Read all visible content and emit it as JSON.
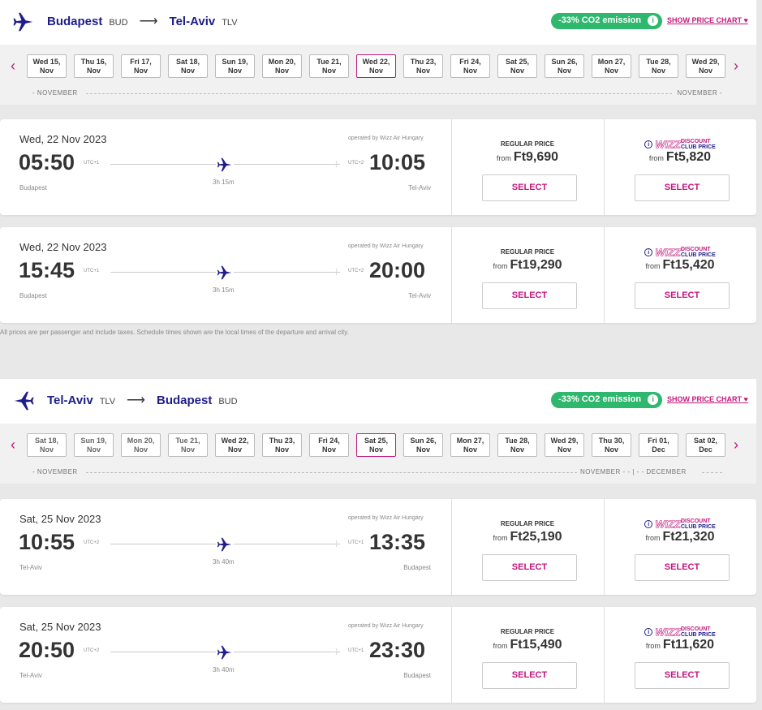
{
  "outbound": {
    "from_city": "Budapest",
    "from_iata": "BUD",
    "to_city": "Tel-Aviv",
    "to_iata": "TLV",
    "co2": "-33% CO2 emission",
    "price_chart": "SHOW PRICE CHART ♥",
    "dates": [
      [
        "Wed 15,",
        "Nov"
      ],
      [
        "Thu 16,",
        "Nov"
      ],
      [
        "Fri 17,",
        "Nov"
      ],
      [
        "Sat 18,",
        "Nov"
      ],
      [
        "Sun 19,",
        "Nov"
      ],
      [
        "Mon 20,",
        "Nov"
      ],
      [
        "Tue 21,",
        "Nov"
      ],
      [
        "Wed 22,",
        "Nov"
      ],
      [
        "Thu 23,",
        "Nov"
      ],
      [
        "Fri 24,",
        "Nov"
      ],
      [
        "Sat 25,",
        "Nov"
      ],
      [
        "Sun 26,",
        "Nov"
      ],
      [
        "Mon 27,",
        "Nov"
      ],
      [
        "Tue 28,",
        "Nov"
      ],
      [
        "Wed 29,",
        "Nov"
      ]
    ],
    "selected_date_index": 7,
    "month_left": "NOVEMBER",
    "month_right": "NOVEMBER",
    "flights": [
      {
        "date": "Wed, 22 Nov 2023",
        "operator": "operated by Wizz Air Hungary",
        "dep": "05:50",
        "dep_tz": "UTC+1",
        "arr": "10:05",
        "arr_tz": "UTC+2",
        "duration": "3h 15m",
        "from": "Budapest",
        "to": "Tel-Aviv",
        "regular_label": "REGULAR PRICE",
        "from_label": "from",
        "regular_price": "Ft9,690",
        "club_price": "Ft5,820",
        "select": "SELECT"
      },
      {
        "date": "Wed, 22 Nov 2023",
        "operator": "operated by Wizz Air Hungary",
        "dep": "15:45",
        "dep_tz": "UTC+1",
        "arr": "20:00",
        "arr_tz": "UTC+2",
        "duration": "3h 15m",
        "from": "Budapest",
        "to": "Tel-Aviv",
        "regular_label": "REGULAR PRICE",
        "from_label": "from",
        "regular_price": "Ft19,290",
        "club_price": "Ft15,420",
        "select": "SELECT"
      }
    ]
  },
  "disclaimer": "All prices are per passenger and include taxes. Schedule times shown are the local times of the departure and arrival city.",
  "inbound": {
    "from_city": "Tel-Aviv",
    "from_iata": "TLV",
    "to_city": "Budapest",
    "to_iata": "BUD",
    "co2": "-33% CO2 emission",
    "price_chart": "SHOW PRICE CHART ♥",
    "dates": [
      [
        "Sat 18,",
        "Nov"
      ],
      [
        "Sun 19,",
        "Nov"
      ],
      [
        "Mon 20,",
        "Nov"
      ],
      [
        "Tue 21,",
        "Nov"
      ],
      [
        "Wed 22,",
        "Nov"
      ],
      [
        "Thu 23,",
        "Nov"
      ],
      [
        "Fri 24,",
        "Nov"
      ],
      [
        "Sat 25,",
        "Nov"
      ],
      [
        "Sun 26,",
        "Nov"
      ],
      [
        "Mon 27,",
        "Nov"
      ],
      [
        "Tue 28,",
        "Nov"
      ],
      [
        "Wed 29,",
        "Nov"
      ],
      [
        "Thu 30,",
        "Nov"
      ],
      [
        "Fri 01,",
        "Dec"
      ],
      [
        "Sat 02,",
        "Dec"
      ]
    ],
    "selected_date_index": 7,
    "month_left": "NOVEMBER",
    "month_mid": "NOVEMBER",
    "month_right": "DECEMBER",
    "flights": [
      {
        "date": "Sat, 25 Nov 2023",
        "operator": "operated by Wizz Air Hungary",
        "dep": "10:55",
        "dep_tz": "UTC+2",
        "arr": "13:35",
        "arr_tz": "UTC+1",
        "duration": "3h 40m",
        "from": "Tel-Aviv",
        "to": "Budapest",
        "regular_label": "REGULAR PRICE",
        "from_label": "from",
        "regular_price": "Ft25,190",
        "club_price": "Ft21,320",
        "select": "SELECT"
      },
      {
        "date": "Sat, 25 Nov 2023",
        "operator": "operated by Wizz Air Hungary",
        "dep": "20:50",
        "dep_tz": "UTC+2",
        "arr": "23:30",
        "arr_tz": "UTC+1",
        "duration": "3h 40m",
        "from": "Tel-Aviv",
        "to": "Budapest",
        "regular_label": "REGULAR PRICE",
        "from_label": "from",
        "regular_price": "Ft15,490",
        "club_price": "Ft11,620",
        "select": "SELECT"
      }
    ]
  },
  "club_brand": "WIZZ",
  "club_line1": "DISCOUNT",
  "club_line2": "CLUB PRICE",
  "colors": {
    "brand_navy": "#1e1e8a",
    "brand_magenta": "#c3177d",
    "co2_green": "#2eb86e"
  }
}
